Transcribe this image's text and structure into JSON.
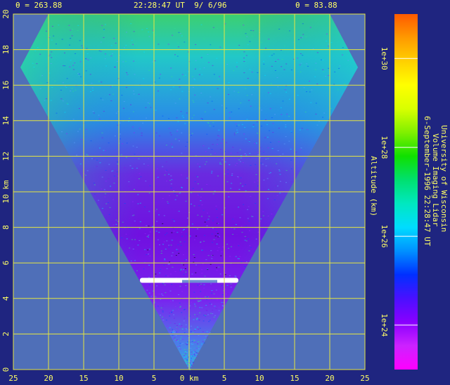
{
  "header": {
    "theta_left": "θ = 263.88",
    "timestamp": "22:28:47 UT  9/ 6/96",
    "theta_right": "θ = 83.88"
  },
  "side_text": {
    "line1": "University of Wisconsin",
    "line2": "Volume Imaging Lidar",
    "line3": "6-September-1996 22:28:47 UT"
  },
  "colors": {
    "background": "#1f2580",
    "plot_bg": "#4f6fb8",
    "grid": "#e6e640",
    "label": "#ffff66"
  },
  "chart_data": {
    "type": "heatmap",
    "title": "",
    "xlabel": "0 km",
    "ylabel": "Altitude (km)",
    "xlim": [
      -25,
      25
    ],
    "ylim": [
      0,
      20
    ],
    "grid": true,
    "x_ticks": [
      25,
      20,
      15,
      10,
      5,
      0,
      5,
      10,
      15,
      20,
      25
    ],
    "y_ticks": [
      0,
      2,
      4,
      6,
      8,
      10,
      12,
      14,
      16,
      18,
      20
    ],
    "x_tick_labels": [
      "25",
      "20",
      "15",
      "10",
      "5",
      "0 km",
      "5",
      "10",
      "15",
      "20",
      "25"
    ],
    "y_tick_labels": [
      "0",
      "2",
      "4",
      "6",
      "8",
      "10 km",
      "12",
      "14",
      "16",
      "18",
      "20"
    ],
    "y_right_label": "Altitude (km)",
    "scan_angles_deg": [
      263.88,
      83.88
    ],
    "cloud_layer": {
      "x_range_km": [
        -7,
        7
      ],
      "altitude_km": 5.0
    },
    "colorbar": {
      "scale": "log",
      "range": [
        1e+23,
        1e+31
      ],
      "tick_values": [
        1e+24,
        1e+26,
        1e+28,
        1e+30
      ],
      "tick_labels": [
        "1e+24",
        "1e+26",
        "1e+28",
        "1e+30"
      ],
      "colors_low_to_high": [
        "#ff00ff",
        "#cc22ff",
        "#8a00ff",
        "#4a10ff",
        "#0030ff",
        "#0090ff",
        "#00dcff",
        "#00e8c0",
        "#00e070",
        "#10e000",
        "#80f000",
        "#d8ff00",
        "#ffff00",
        "#ffd000",
        "#ff9a00",
        "#ff5a00"
      ]
    }
  }
}
